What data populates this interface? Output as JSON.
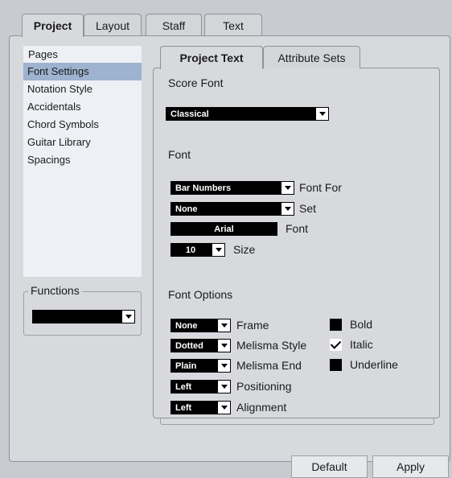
{
  "top_tabs": [
    {
      "label": "Project",
      "active": true
    },
    {
      "label": "Layout",
      "active": false
    },
    {
      "label": "Staff",
      "active": false
    },
    {
      "label": "Text",
      "active": false
    }
  ],
  "pages": {
    "header": "Pages",
    "items": [
      {
        "label": "Font Settings",
        "selected": true
      },
      {
        "label": "Notation Style",
        "selected": false
      },
      {
        "label": "Accidentals",
        "selected": false
      },
      {
        "label": "Chord Symbols",
        "selected": false
      },
      {
        "label": "Guitar Library",
        "selected": false
      },
      {
        "label": "Spacings",
        "selected": false
      }
    ]
  },
  "functions": {
    "title": "Functions",
    "value": ""
  },
  "sub_tabs": [
    {
      "label": "Project Text",
      "active": true
    },
    {
      "label": "Attribute Sets",
      "active": false
    }
  ],
  "score_font": {
    "title": "Score Font",
    "value": "Classical"
  },
  "font": {
    "title": "Font",
    "font_for": {
      "value": "Bar Numbers",
      "label": "Font For"
    },
    "set": {
      "value": "None",
      "label": "Set"
    },
    "font": {
      "value": "Arial",
      "label": "Font"
    },
    "size": {
      "value": "10",
      "label": "Size"
    }
  },
  "font_options": {
    "title": "Font Options",
    "frame": {
      "value": "None",
      "label": "Frame"
    },
    "melisma_style": {
      "value": "Dotted",
      "label": "Melisma Style"
    },
    "melisma_end": {
      "value": "Plain",
      "label": "Melisma End"
    },
    "positioning": {
      "value": "Left",
      "label": "Positioning"
    },
    "alignment": {
      "value": "Left",
      "label": "Alignment"
    },
    "bold": {
      "label": "Bold",
      "checked": false
    },
    "italic": {
      "label": "Italic",
      "checked": true
    },
    "underline": {
      "label": "Underline",
      "checked": false
    }
  },
  "buttons": {
    "default": "Default",
    "apply": "Apply"
  }
}
